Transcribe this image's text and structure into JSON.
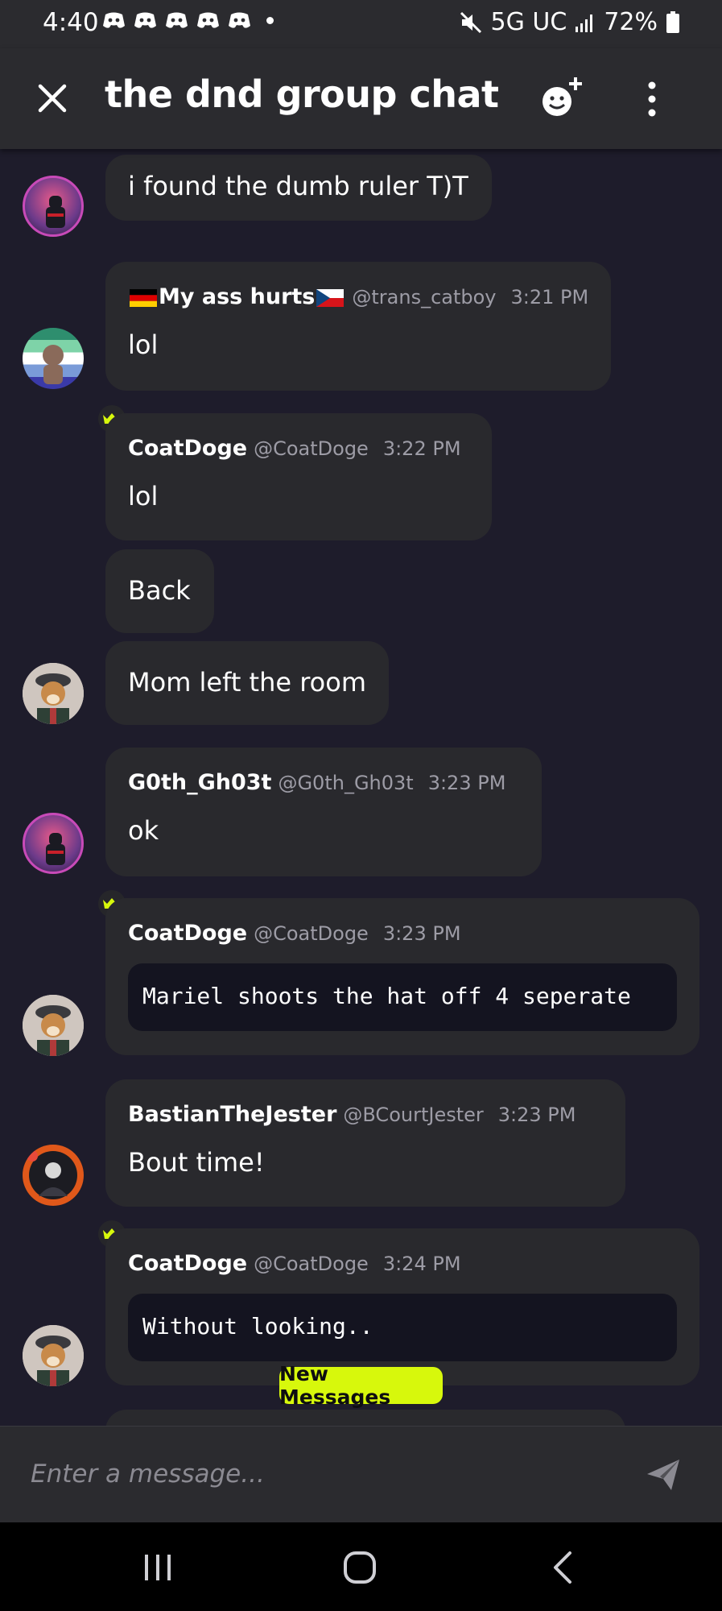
{
  "status_bar": {
    "time": "4:40",
    "network": "5G UC",
    "battery": "72%",
    "icons": [
      "discord-icon",
      "discord-icon",
      "discord-icon",
      "discord-icon",
      "discord-icon",
      "dot-icon",
      "mute-icon",
      "signal-icon",
      "battery-icon"
    ]
  },
  "header": {
    "title": "the dnd group chat",
    "icons": [
      "close-icon",
      "add-emoji-icon",
      "more-vertical-icon"
    ]
  },
  "messages": [
    {
      "text": "i found the dumb ruler T)T"
    },
    {
      "author": "My ass hurts",
      "handle": "@trans_catboy",
      "time": "3:21 PM",
      "text": "lol",
      "flags": [
        "german-flag",
        "czech-flag"
      ]
    },
    {
      "author": "CoatDoge",
      "handle": "@CoatDoge",
      "time": "3:22 PM",
      "text": "lol",
      "crown": true
    },
    {
      "text": "Back"
    },
    {
      "text": "Mom left the room"
    },
    {
      "author": "G0th_Gh03t",
      "handle": "@G0th_Gh03t",
      "time": "3:23 PM",
      "text": "ok"
    },
    {
      "author": "CoatDoge",
      "handle": "@CoatDoge",
      "time": "3:23 PM",
      "code": "Mariel shoots the hat off 4 seperate",
      "crown": true
    },
    {
      "author": "BastianTheJester",
      "handle": "@BCourtJester",
      "time": "3:23 PM",
      "text": "Bout time!"
    },
    {
      "author": "CoatDoge",
      "handle": "@CoatDoge",
      "time": "3:24 PM",
      "code": "Without looking..",
      "crown": true
    }
  ],
  "new_messages_label": "New Messages",
  "composer": {
    "placeholder": "Enter a message..."
  },
  "nav_bar": {
    "icons": [
      "recent-apps-icon",
      "home-icon",
      "back-icon"
    ]
  },
  "colors": {
    "background": "#1e1c2b",
    "bar": "#2b2b2f",
    "bubble": "#29292d",
    "code_block": "#141420",
    "accent": "#d7f80c",
    "muted_text": "#9d9ca6"
  }
}
